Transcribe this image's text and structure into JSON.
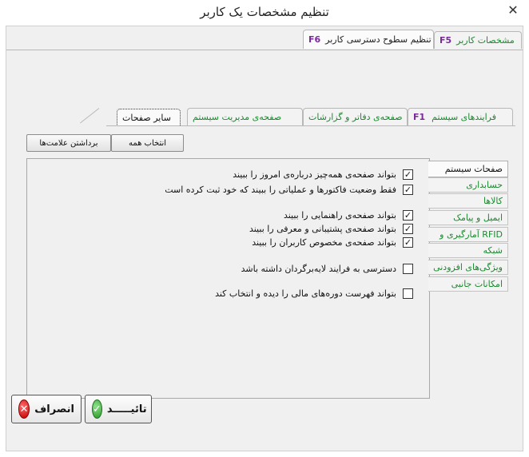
{
  "window": {
    "title": "تنظیم مشخصات یک کاربر",
    "close_glyph": "✕"
  },
  "main_tabs": [
    {
      "label": "مشخصات کاربر",
      "key": "F5"
    },
    {
      "label": "تنظیم سطوح دسترسی کاربر",
      "key": "F6"
    }
  ],
  "inner_tabs": [
    {
      "label": "فرایندهای سیستم",
      "key": "F1"
    },
    {
      "label": "صفحه‌ی دفاتر و گزارشات"
    },
    {
      "label": "صفحه‌ی مدیریت سیستم"
    },
    {
      "label": "سایر صفحات"
    }
  ],
  "toolbar": {
    "select_all": "انتخاب همه",
    "clear_marks": "برداشتن علامت‌ها"
  },
  "checks": [
    {
      "label": "بتواند صفحه‌ی همه‌چیز درباره‌ی امروز را ببیند",
      "checked": true,
      "mark": "✓"
    },
    {
      "label": "فقط وضعیت فاکتورها و عملیاتی را ببیند که خود ثبت کرده است",
      "checked": true,
      "mark": "✓"
    },
    {
      "label": "بتواند صفحه‌ی راهنمایی را ببیند",
      "checked": true,
      "mark": "✓"
    },
    {
      "label": "بتواند صفحه‌ی پشتیبانی و معرفی را ببیند",
      "checked": true,
      "mark": "✓"
    },
    {
      "label": "بتواند صفحه‌ی مخصوص کاربران را ببیند",
      "checked": true,
      "mark": "✓"
    },
    {
      "label": "دسترسی به فرایند لایه‌برگردان داشته باشد",
      "checked": false,
      "mark": ""
    },
    {
      "label": "بتواند فهرست دوره‌های مالی را دیده و انتخاب کند",
      "checked": false,
      "mark": ""
    }
  ],
  "side_tabs": [
    "صفحات سیستم",
    "حسابداری",
    "کالاها",
    "ایمیل و پیامک",
    "آمارگیری و RFID",
    "شبکه",
    "ویژگی‌های افزودنی",
    "امکانات جانبی"
  ],
  "footer": {
    "cancel": "انصراف",
    "confirm": "تائیـــــد",
    "cancel_icon": "✕",
    "confirm_icon": "✓"
  },
  "colors": {
    "tab_green": "#1a8a2e",
    "hotkey_purple": "#7a2a9a"
  }
}
